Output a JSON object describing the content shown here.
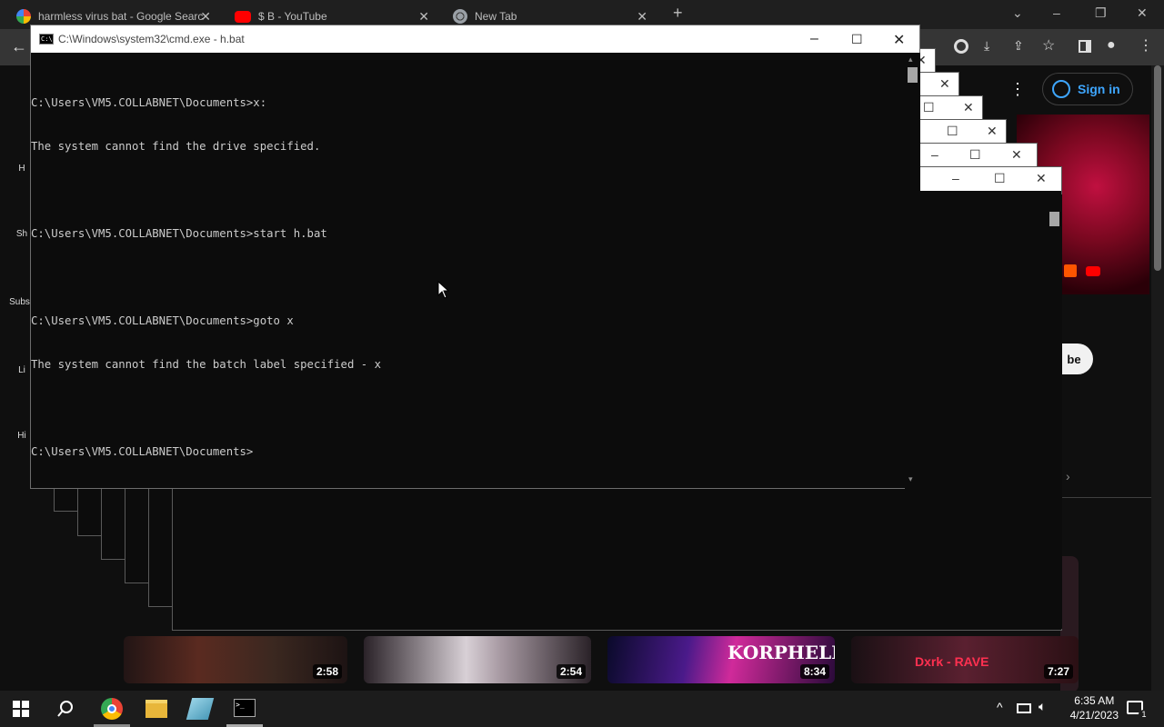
{
  "browser": {
    "tabs": [
      {
        "title": "harmless virus bat - Google Searc",
        "favicon": "google-icon"
      },
      {
        "title": "$ B - YouTube",
        "favicon": "youtube-icon"
      },
      {
        "title": "New Tab",
        "favicon": "chrome-icon"
      }
    ],
    "new_tab_symbol": "+",
    "sign_in_label": "Sign in"
  },
  "youtube": {
    "sidebar_fragments": [
      "H",
      "Sh",
      "Subsc",
      "Li",
      "Hi"
    ],
    "subscribe_fragment": "be",
    "durations": [
      "2:58",
      "2:54",
      "8:34",
      "7:27"
    ],
    "thumb_texts": [
      "KORPHELL",
      "Dxrk - RAVE"
    ]
  },
  "cmd": {
    "title": "C:\\Windows\\system32\\cmd.exe - h.bat",
    "lines": [
      "C:\\Users\\VM5.COLLABNET\\Documents>x:",
      "The system cannot find the drive specified.",
      "",
      "C:\\Users\\VM5.COLLABNET\\Documents>start h.bat",
      "",
      "C:\\Users\\VM5.COLLABNET\\Documents>goto x",
      "The system cannot find the batch label specified - x",
      "",
      "C:\\Users\\VM5.COLLABNET\\Documents>"
    ]
  },
  "taskbar": {
    "time": "6:35 AM",
    "date": "4/21/2023",
    "notification_count": "1"
  },
  "colors": {
    "console_bg": "#0c0c0c",
    "console_text": "#cccccc",
    "signin_blue": "#3ea6ff",
    "taskbar_bg": "#1c1c1c"
  }
}
